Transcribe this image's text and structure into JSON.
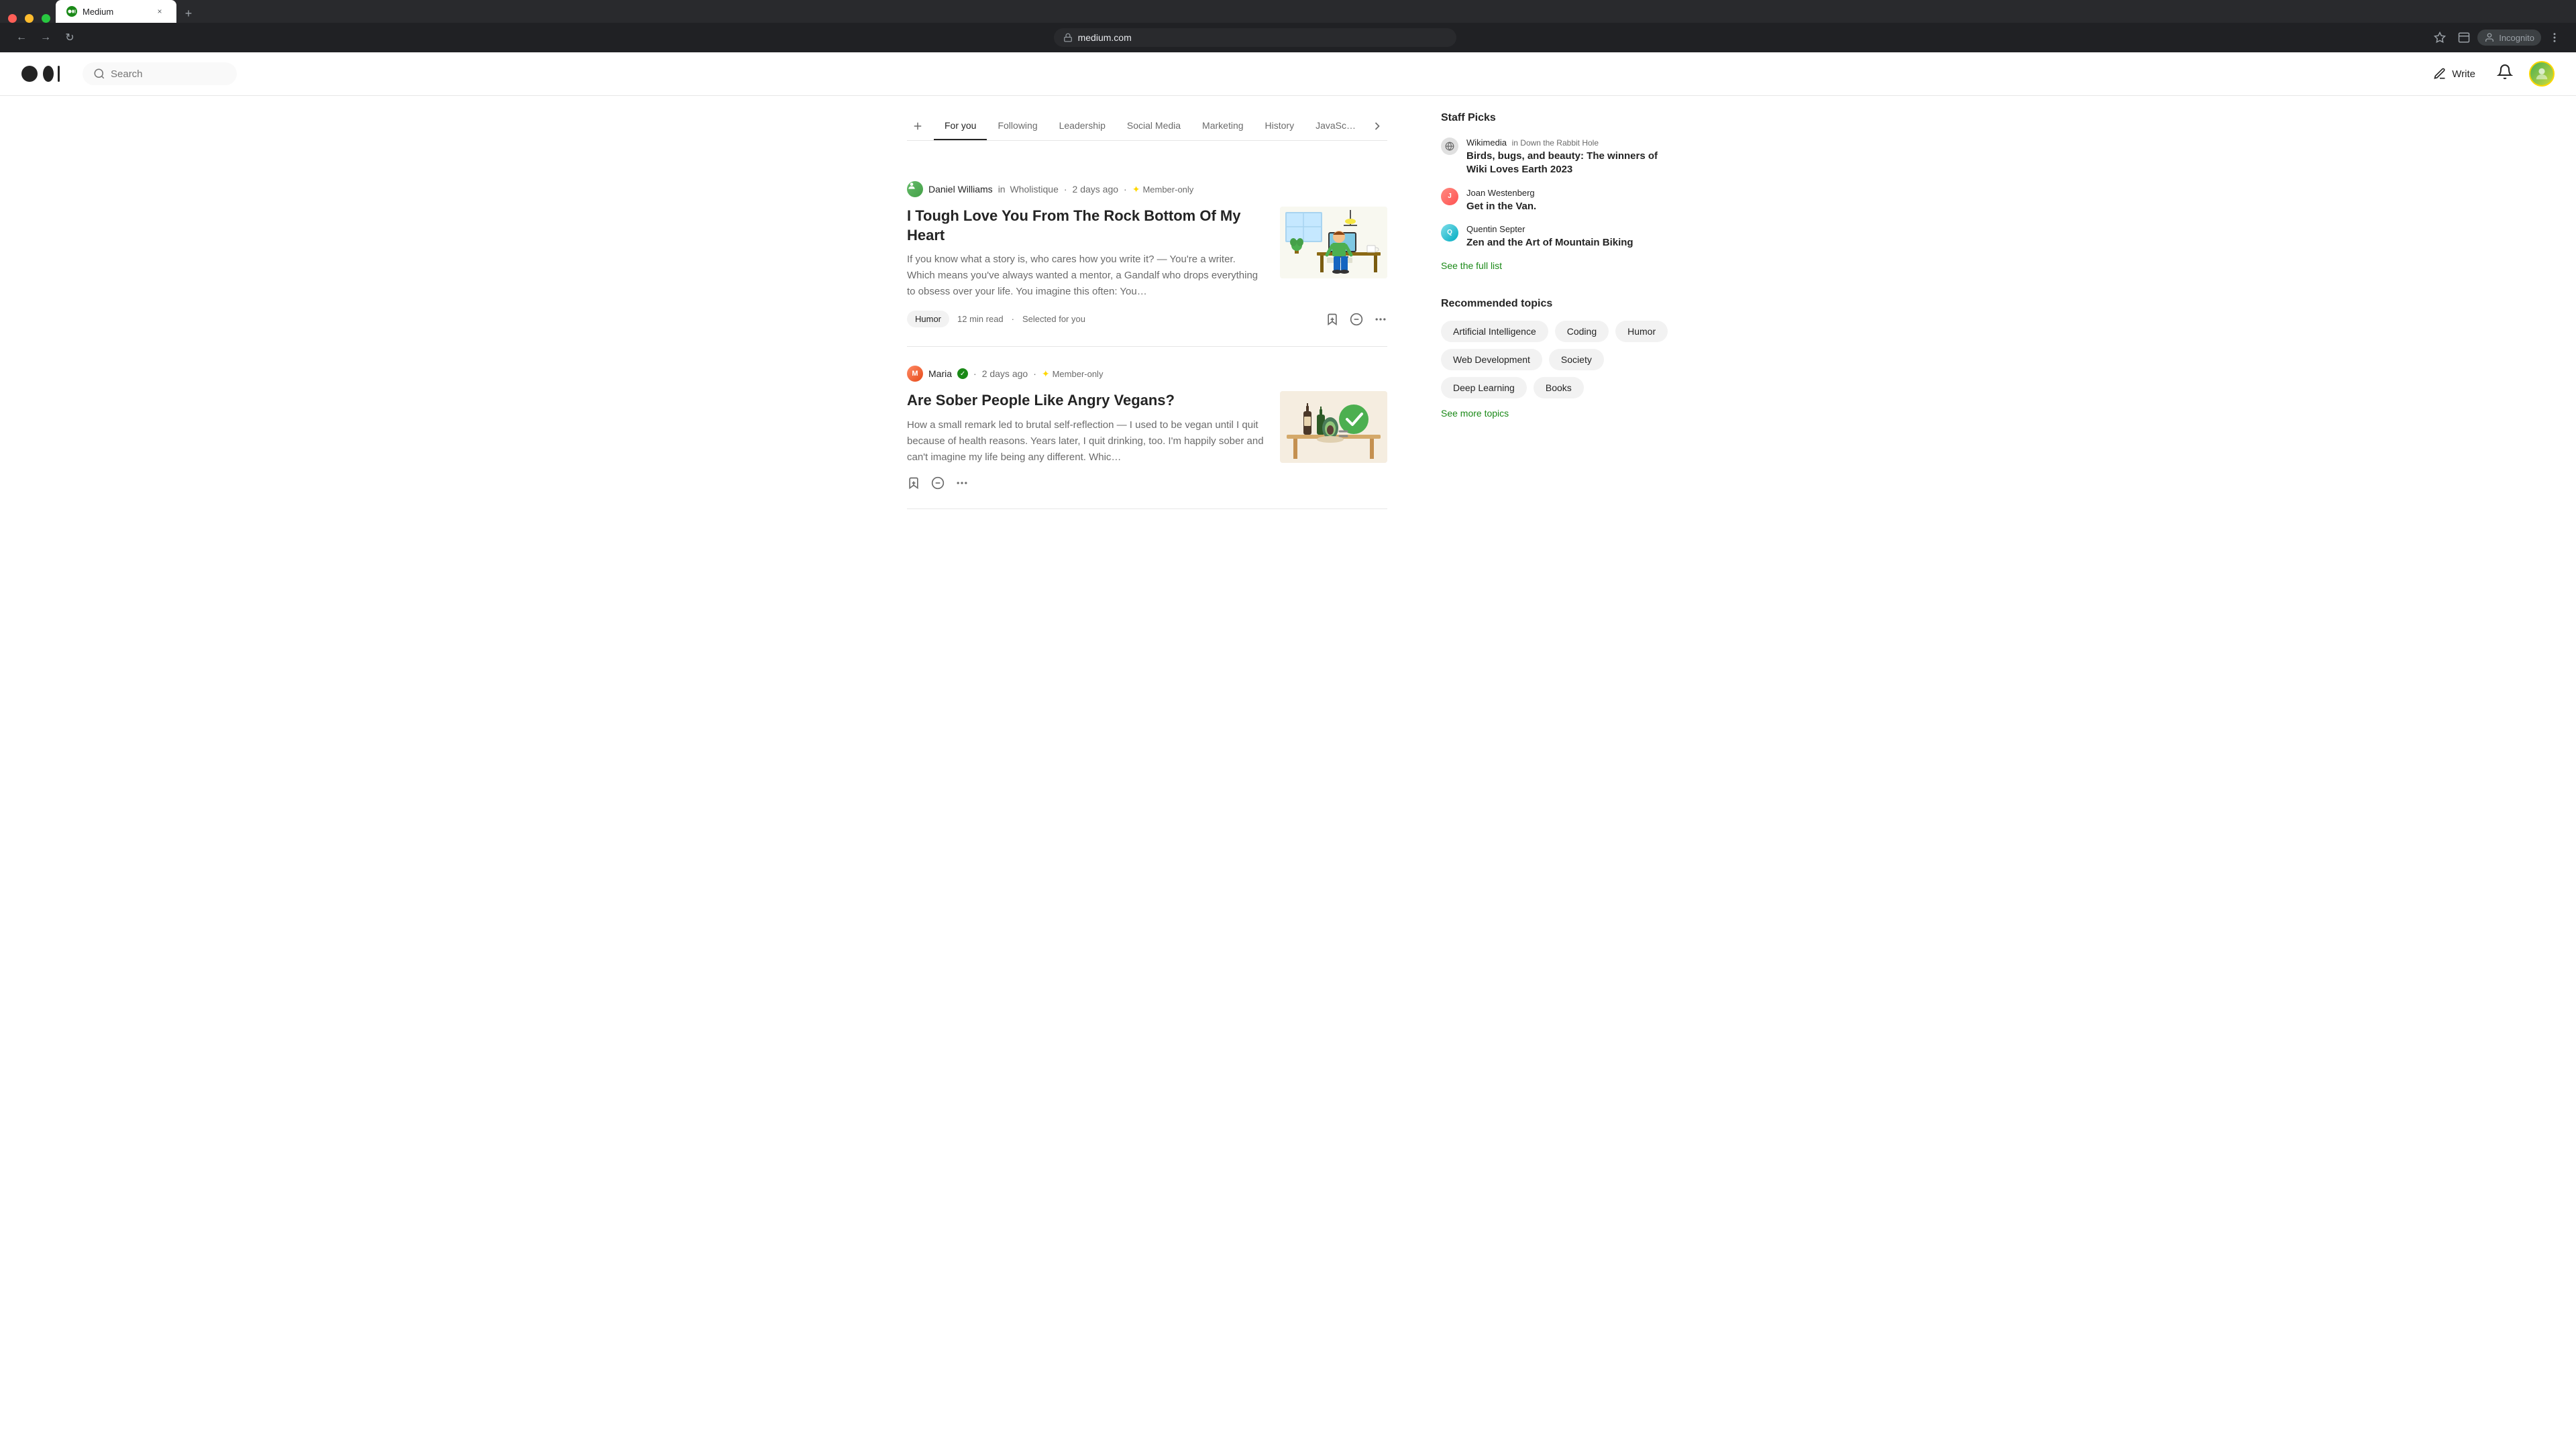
{
  "browser": {
    "tab_title": "Medium",
    "tab_favicon": "M",
    "url": "medium.com",
    "incognito_label": "Incognito",
    "back_icon": "←",
    "forward_icon": "→",
    "refresh_icon": "↻",
    "new_tab_icon": "+",
    "close_tab_icon": "×",
    "star_icon": "☆",
    "layout_icon": "⊞",
    "more_icon": "⋮",
    "close_win_icon": "×",
    "min_win_icon": "−",
    "max_win_icon": "□"
  },
  "header": {
    "search_placeholder": "Search",
    "write_label": "Write",
    "logo_alt": "Medium"
  },
  "nav_tabs": {
    "add_icon": "+",
    "more_icon": "›",
    "items": [
      {
        "id": "for-you",
        "label": "For you",
        "active": true
      },
      {
        "id": "following",
        "label": "Following",
        "active": false
      },
      {
        "id": "leadership",
        "label": "Leadership",
        "active": false
      },
      {
        "id": "social-media",
        "label": "Social Media",
        "active": false
      },
      {
        "id": "marketing",
        "label": "Marketing",
        "active": false
      },
      {
        "id": "history",
        "label": "History",
        "active": false
      },
      {
        "id": "javascript",
        "label": "JavaSc…",
        "active": false
      }
    ]
  },
  "articles": [
    {
      "id": "article-1",
      "author_name": "Daniel Williams",
      "author_publication_prefix": "in",
      "author_publication": "Wholistique",
      "date": "2 days ago",
      "member_only": true,
      "member_label": "Member-only",
      "title": "I Tough Love You From The Rock Bottom Of My Heart",
      "excerpt": "If you know what a story is, who cares how you write it? — You're a writer. Which means you've always wanted a mentor, a Gandalf who drops everything to obsess over your life. You imagine this often: You…",
      "tag": "Humor",
      "read_time": "12 min read",
      "selected_label": "Selected for you"
    },
    {
      "id": "article-2",
      "author_name": "Maria",
      "author_verified": true,
      "date": "2 days ago",
      "member_only": true,
      "member_label": "Member-only",
      "title": "Are Sober People Like Angry Vegans?",
      "excerpt": "How a small remark led to brutal self-reflection — I used to be vegan until I quit because of health reasons. Years later, I quit drinking, too. I'm happily sober and can't imagine my life being any different. Whic…",
      "tag": null,
      "read_time": null,
      "selected_label": null
    }
  ],
  "sidebar": {
    "staff_picks_title": "Staff Picks",
    "staff_picks": [
      {
        "id": "pick-1",
        "author": "Wikimedia",
        "publication_prefix": "in",
        "publication": "Down the Rabbit Hole",
        "title": "Birds, bugs, and beauty: The winners of Wiki Loves Earth 2023"
      },
      {
        "id": "pick-2",
        "author": "Joan Westenberg",
        "publication": null,
        "title": "Get in the Van."
      },
      {
        "id": "pick-3",
        "author": "Quentin Septer",
        "publication": null,
        "title": "Zen and the Art of Mountain Biking"
      }
    ],
    "see_full_list_label": "See the full list",
    "recommended_topics_title": "Recommended topics",
    "topics": [
      {
        "id": "ai",
        "label": "Artificial Intelligence"
      },
      {
        "id": "coding",
        "label": "Coding"
      },
      {
        "id": "humor",
        "label": "Humor"
      },
      {
        "id": "web-dev",
        "label": "Web Development"
      },
      {
        "id": "society",
        "label": "Society"
      },
      {
        "id": "deep-learning",
        "label": "Deep Learning"
      },
      {
        "id": "books",
        "label": "Books"
      }
    ],
    "see_more_topics_label": "See more topics"
  }
}
